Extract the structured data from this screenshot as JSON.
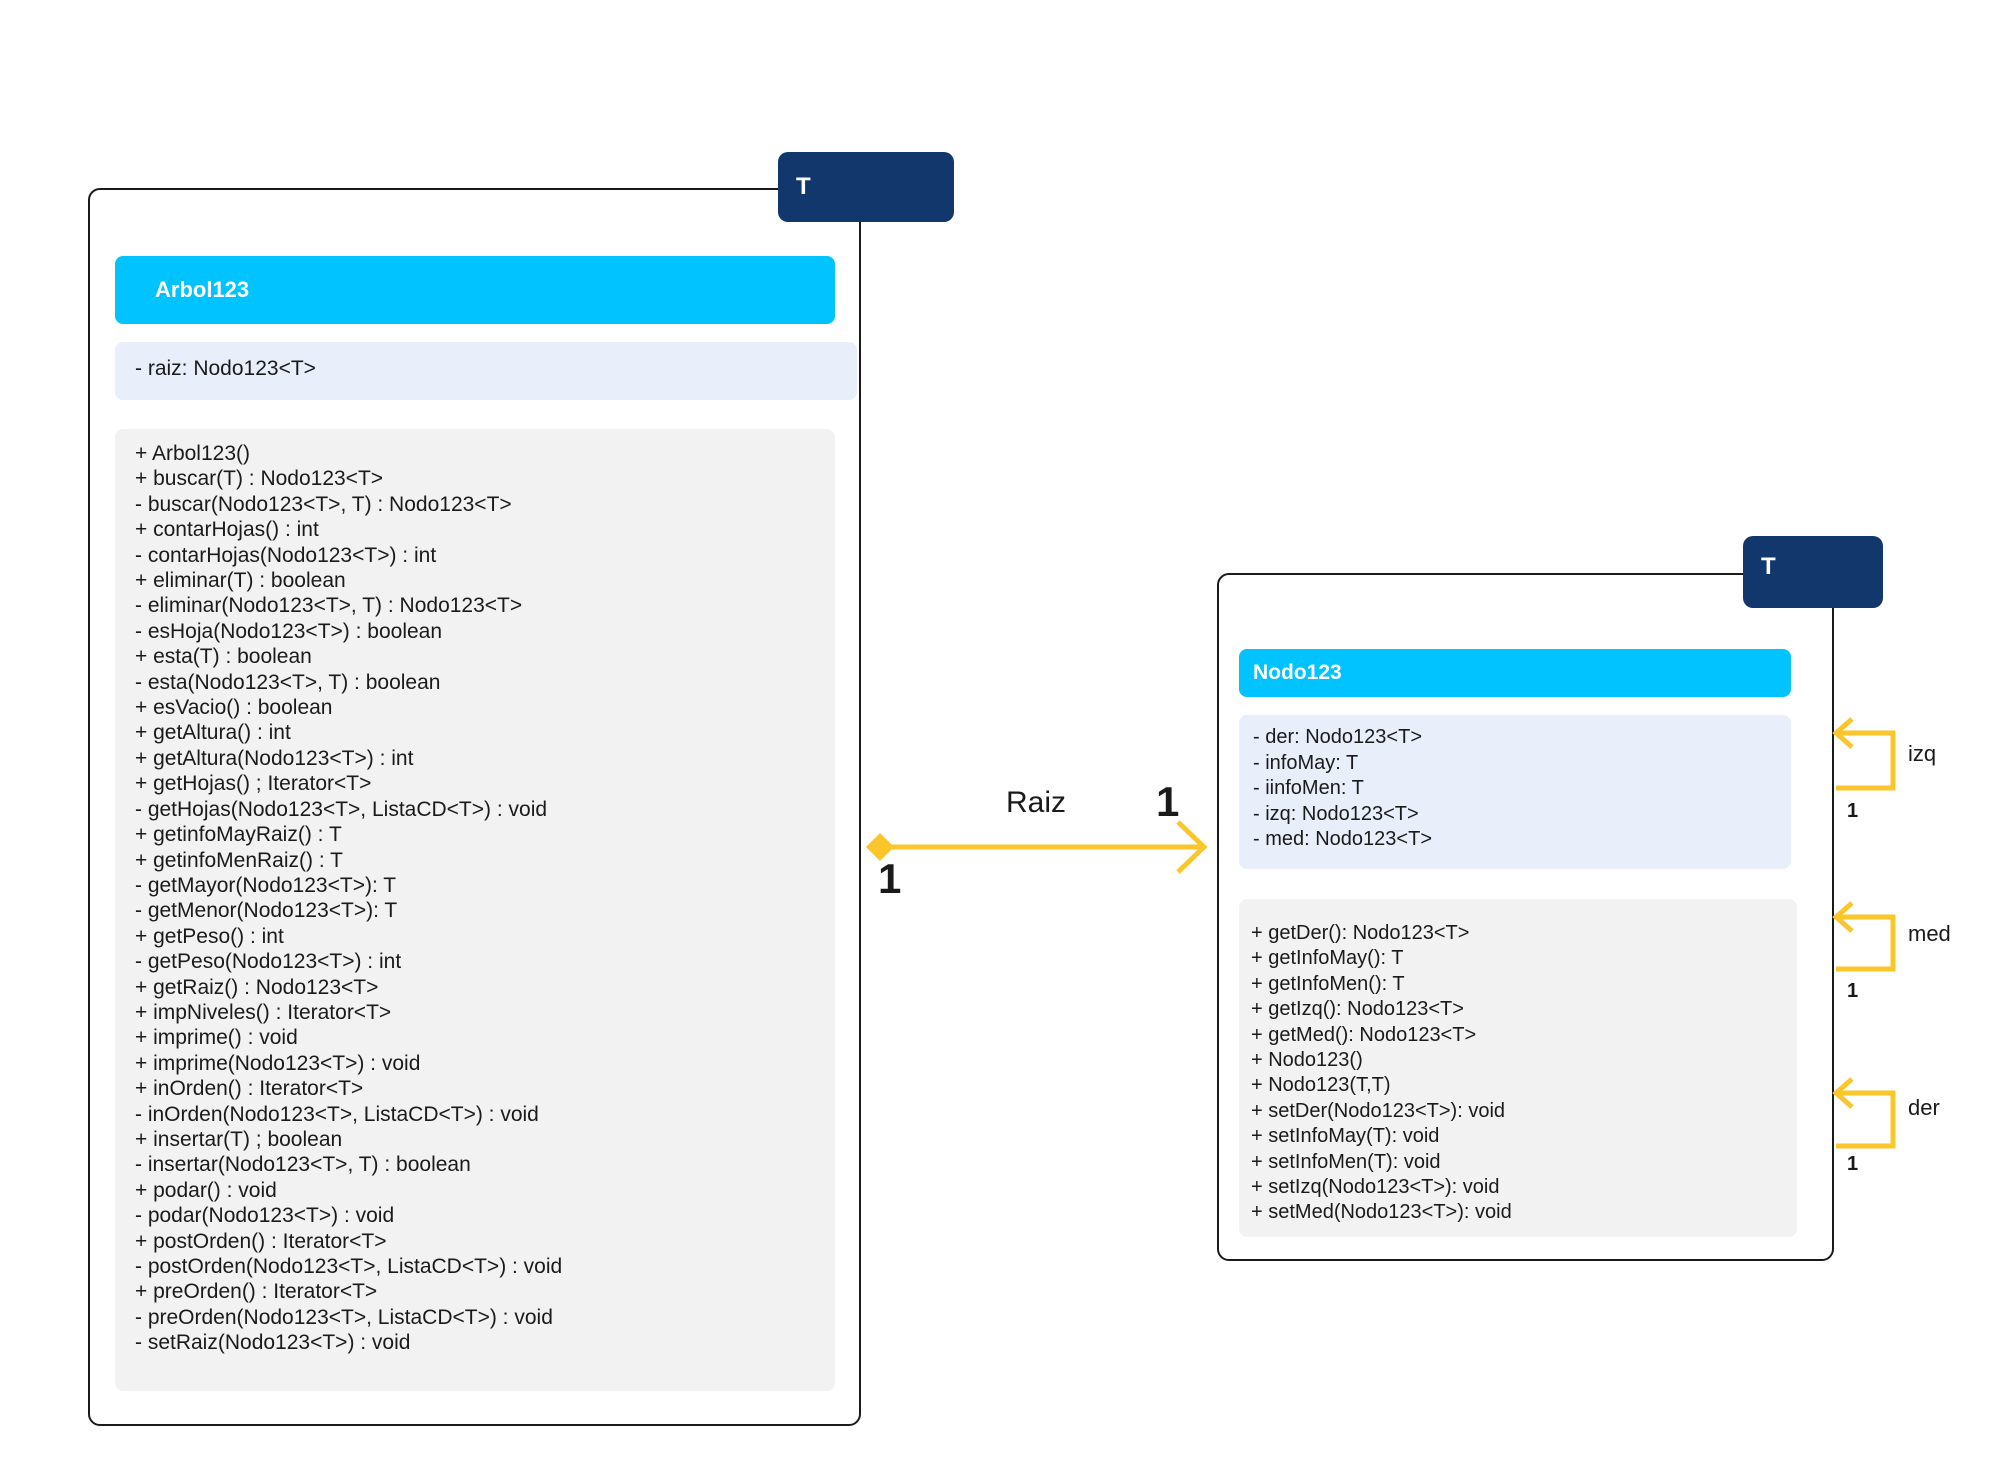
{
  "arbol": {
    "template": "T",
    "name": "Arbol123",
    "attributes": [
      "- raiz: Nodo123<T>"
    ],
    "methods": [
      "+ Arbol123()",
      "+ buscar(T) : Nodo123<T>",
      "- buscar(Nodo123<T>, T) : Nodo123<T>",
      "+ contarHojas() : int",
      "- contarHojas(Nodo123<T>) : int",
      "+ eliminar(T) : boolean",
      "- eliminar(Nodo123<T>, T) : Nodo123<T>",
      "- esHoja(Nodo123<T>) : boolean",
      "+ esta(T) : boolean",
      "- esta(Nodo123<T>, T) : boolean",
      "+ esVacio() : boolean",
      "+ getAltura() : int",
      "+ getAltura(Nodo123<T>) : int",
      "+ getHojas() ; Iterator<T>",
      "- getHojas(Nodo123<T>, ListaCD<T>) : void",
      "+ getinfoMayRaiz() : T",
      "+ getinfoMenRaiz() : T",
      "- getMayor(Nodo123<T>): T",
      "- getMenor(Nodo123<T>): T",
      "+ getPeso() : int",
      "- getPeso(Nodo123<T>) : int",
      "+ getRaiz() : Nodo123<T>",
      "+ impNiveles() : Iterator<T>",
      "+ imprime() : void",
      "+ imprime(Nodo123<T>) : void",
      "+ inOrden() : Iterator<T>",
      "- inOrden(Nodo123<T>, ListaCD<T>) : void",
      "+ insertar(T) ; boolean",
      "- insertar(Nodo123<T>, T) : boolean",
      "+ podar() : void",
      "- podar(Nodo123<T>) : void",
      "+ postOrden() : Iterator<T>",
      "- postOrden(Nodo123<T>, ListaCD<T>) : void",
      "+ preOrden() : Iterator<T>",
      "- preOrden(Nodo123<T>, ListaCD<T>) : void",
      "- setRaiz(Nodo123<T>) : void"
    ]
  },
  "nodo": {
    "template": "T",
    "name": "Nodo123",
    "attributes": [
      "- der: Nodo123<T>",
      "- infoMay: T",
      "- iinfoMen: T",
      "- izq: Nodo123<T>",
      "- med: Nodo123<T>"
    ],
    "methods": [
      "+ getDer(): Nodo123<T>",
      "+ getInfoMay(): T",
      "+ getInfoMen(): T",
      "+ getIzq(): Nodo123<T>",
      "+ getMed(): Nodo123<T>",
      "+ Nodo123()",
      "+ Nodo123(T,T)",
      "+ setDer(Nodo123<T>): void",
      "+ setInfoMay(T): void",
      "+ setInfoMen(T): void",
      "+ setIzq(Nodo123<T>): void",
      "+ setMed(Nodo123<T>): void"
    ]
  },
  "association": {
    "label": "Raiz",
    "source_multiplicity": "1",
    "target_multiplicity": "1"
  },
  "self_associations": [
    {
      "label": "izq",
      "multiplicity": "1"
    },
    {
      "label": "med",
      "multiplicity": "1"
    },
    {
      "label": "der",
      "multiplicity": "1"
    }
  ],
  "colors": {
    "template_tab": "#11376d",
    "class_title": "#00c3ff",
    "attributes_bg": "#e8eefa",
    "methods_bg": "#f2f2f2",
    "connector": "#fbc62c"
  }
}
